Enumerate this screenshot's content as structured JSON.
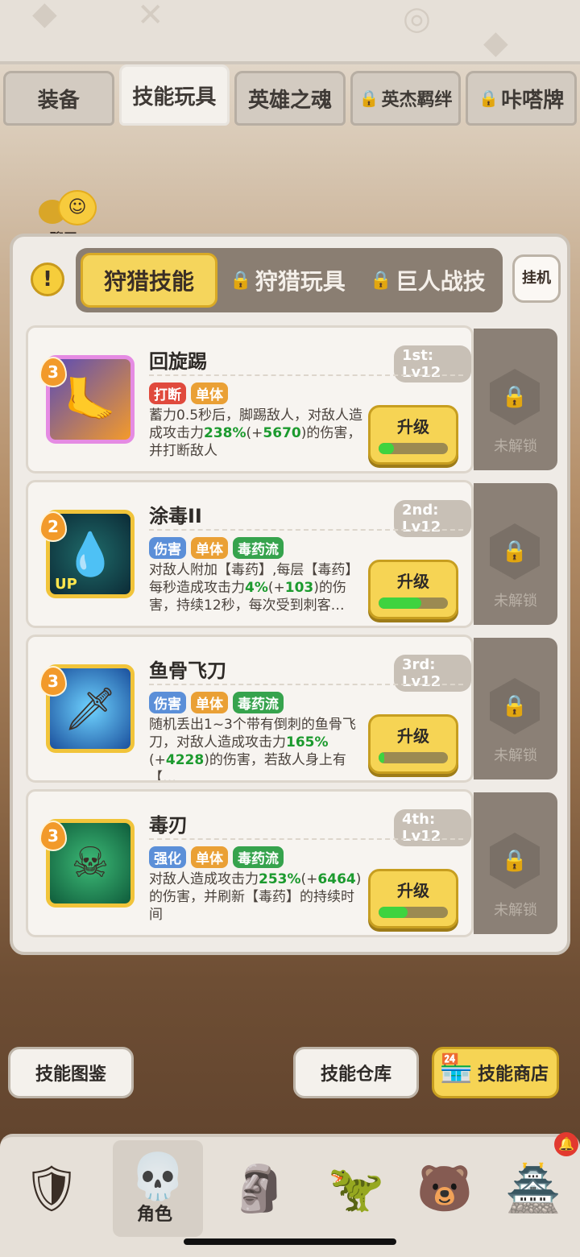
{
  "top_tabs": [
    {
      "label": "装备",
      "locked": false,
      "active": false
    },
    {
      "label": "技能玩具",
      "locked": false,
      "active": true
    },
    {
      "label": "英雄之魂",
      "locked": false,
      "active": false
    },
    {
      "label": "英杰羁绊",
      "locked": true,
      "active": false
    },
    {
      "label": "咔嗒牌",
      "locked": true,
      "active": false
    }
  ],
  "chat": {
    "label": "聊天"
  },
  "sub_tabs": [
    {
      "label": "狩猎技能",
      "active": true
    },
    {
      "label": "狩猎玩具",
      "locked": true
    },
    {
      "label": "巨人战技",
      "locked": true
    }
  ],
  "hangup_label": "挂机",
  "skills": [
    {
      "name": "回旋踢",
      "rank_level": "1st: Lv12",
      "badge": "3",
      "icon": "kick-icon",
      "tags": [
        {
          "text": "打断",
          "color": "red"
        },
        {
          "text": "单体",
          "color": "orange"
        }
      ],
      "desc_parts": [
        "蓄力0.5秒后，脚踢敌人，对敌人造成攻击力",
        "238%",
        "(+",
        "5670",
        ")的伤害，并打断敌人"
      ],
      "upgrade_label": "升级",
      "progress": 0.22,
      "locked_label": "未解锁"
    },
    {
      "name": "涂毒II",
      "rank_level": "2nd: Lv12",
      "badge": "2",
      "icon": "poison-drop-icon",
      "tags": [
        {
          "text": "伤害",
          "color": "blue"
        },
        {
          "text": "单体",
          "color": "orange"
        },
        {
          "text": "毒药流",
          "color": "green"
        }
      ],
      "desc_parts": [
        "对敌人附加【毒药】,每层【毒药】每秒造成攻击力",
        "4%",
        "(+",
        "103",
        ")的伤害，持续12秒，每次受到刺客…"
      ],
      "upgrade_label": "升级",
      "progress": 0.62,
      "locked_label": "未解锁"
    },
    {
      "name": "鱼骨飞刀",
      "rank_level": "3rd: Lv12",
      "badge": "3",
      "icon": "fishbone-dagger-icon",
      "tags": [
        {
          "text": "伤害",
          "color": "blue"
        },
        {
          "text": "单体",
          "color": "orange"
        },
        {
          "text": "毒药流",
          "color": "green"
        }
      ],
      "desc_parts": [
        "随机丢出1~3个带有倒刺的鱼骨飞刀，对敌人造成攻击力",
        "165%",
        "(+",
        "4228",
        ")的伤害，若敌人身上有【…"
      ],
      "upgrade_label": "升级",
      "progress": 0.08,
      "locked_label": "未解锁"
    },
    {
      "name": "毒刃",
      "rank_level": "4th: Lv12",
      "badge": "3",
      "icon": "poison-skull-icon",
      "tags": [
        {
          "text": "强化",
          "color": "blue"
        },
        {
          "text": "单体",
          "color": "orange"
        },
        {
          "text": "毒药流",
          "color": "green"
        }
      ],
      "desc_parts": [
        "对敌人造成攻击力",
        "253%",
        "(+",
        "6464",
        ")的伤害，并刷新【毒药】的持续时间"
      ],
      "upgrade_label": "升级",
      "progress": 0.42,
      "locked_label": "未解锁"
    }
  ],
  "bottom_buttons": {
    "codex": "技能图鉴",
    "storage": "技能仓库",
    "shop": "技能商店"
  },
  "nav": [
    {
      "icon": "viking-hero-icon",
      "label": ""
    },
    {
      "icon": "assassin-hero-icon",
      "label": "角色",
      "active": true
    },
    {
      "icon": "tribal-mask-icon",
      "label": ""
    },
    {
      "icon": "dinosaur-icon",
      "label": ""
    },
    {
      "icon": "bear-icon",
      "label": ""
    },
    {
      "icon": "totem-icon",
      "label": ""
    }
  ],
  "colors": {
    "accent_yellow": "#f6d454",
    "progress_green": "#3fd33f",
    "panel": "#efebe6"
  }
}
